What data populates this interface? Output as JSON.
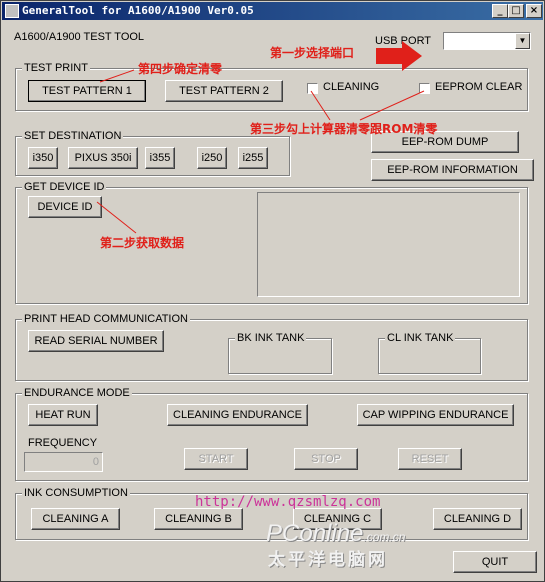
{
  "window": {
    "title": "GeneralTool for A1600/A1900 Ver0.05"
  },
  "header": {
    "model_label": "A1600/A1900 TEST TOOL",
    "usb_port_label": "USB PORT",
    "usb_port_value": ""
  },
  "test_print": {
    "group_label": "TEST PRINT",
    "pattern1": "TEST PATTERN 1",
    "pattern2": "TEST PATTERN 2",
    "cleaning": "CLEANING",
    "eeprom_clear": "EEPROM CLEAR"
  },
  "set_destination": {
    "group_label": "SET DESTINATION",
    "buttons": [
      "i350",
      "PIXUS 350i",
      "i355",
      "i250",
      "i255"
    ]
  },
  "eeprom": {
    "dump": "EEP-ROM DUMP",
    "information": "EEP-ROM INFORMATION"
  },
  "device": {
    "group_label": "GET DEVICE ID",
    "button": "DEVICE ID"
  },
  "print_head": {
    "group_label": "PRINT HEAD COMMUNICATION",
    "read_serial": "READ SERIAL NUMBER",
    "bk_tank": "BK INK TANK",
    "cl_tank": "CL INK TANK"
  },
  "endurance": {
    "group_label": "ENDURANCE MODE",
    "heat_run": "HEAT RUN",
    "cleaning_endurance": "CLEANING ENDURANCE",
    "cap_wiping": "CAP WIPPING ENDURANCE",
    "frequency_label": "FREQUENCY",
    "frequency_value": "0",
    "start": "START",
    "stop": "STOP",
    "reset": "RESET"
  },
  "ink": {
    "group_label": "INK CONSUMPTION",
    "cleaning_a": "CLEANING A",
    "cleaning_b": "CLEANING B",
    "cleaning_c": "CLEANING C",
    "cleaning_d": "CLEANING D"
  },
  "quit": "QUIT",
  "annotations": {
    "step1": "第一步选择端口",
    "step2": "第二步获取数据",
    "step3": "第三步勾上计算器清零跟ROM清零",
    "step4": "第四步确定清零"
  },
  "watermark": {
    "url": "http://www.qzsmlzq.com",
    "site": "PConline",
    "site_suffix": ".com.cn",
    "site_cn": "太平洋电脑网"
  },
  "colors": {
    "titlebar": "#0a246a",
    "annotation": "#e0201a",
    "url": "#cc3399",
    "face": "#d4d0c8"
  }
}
